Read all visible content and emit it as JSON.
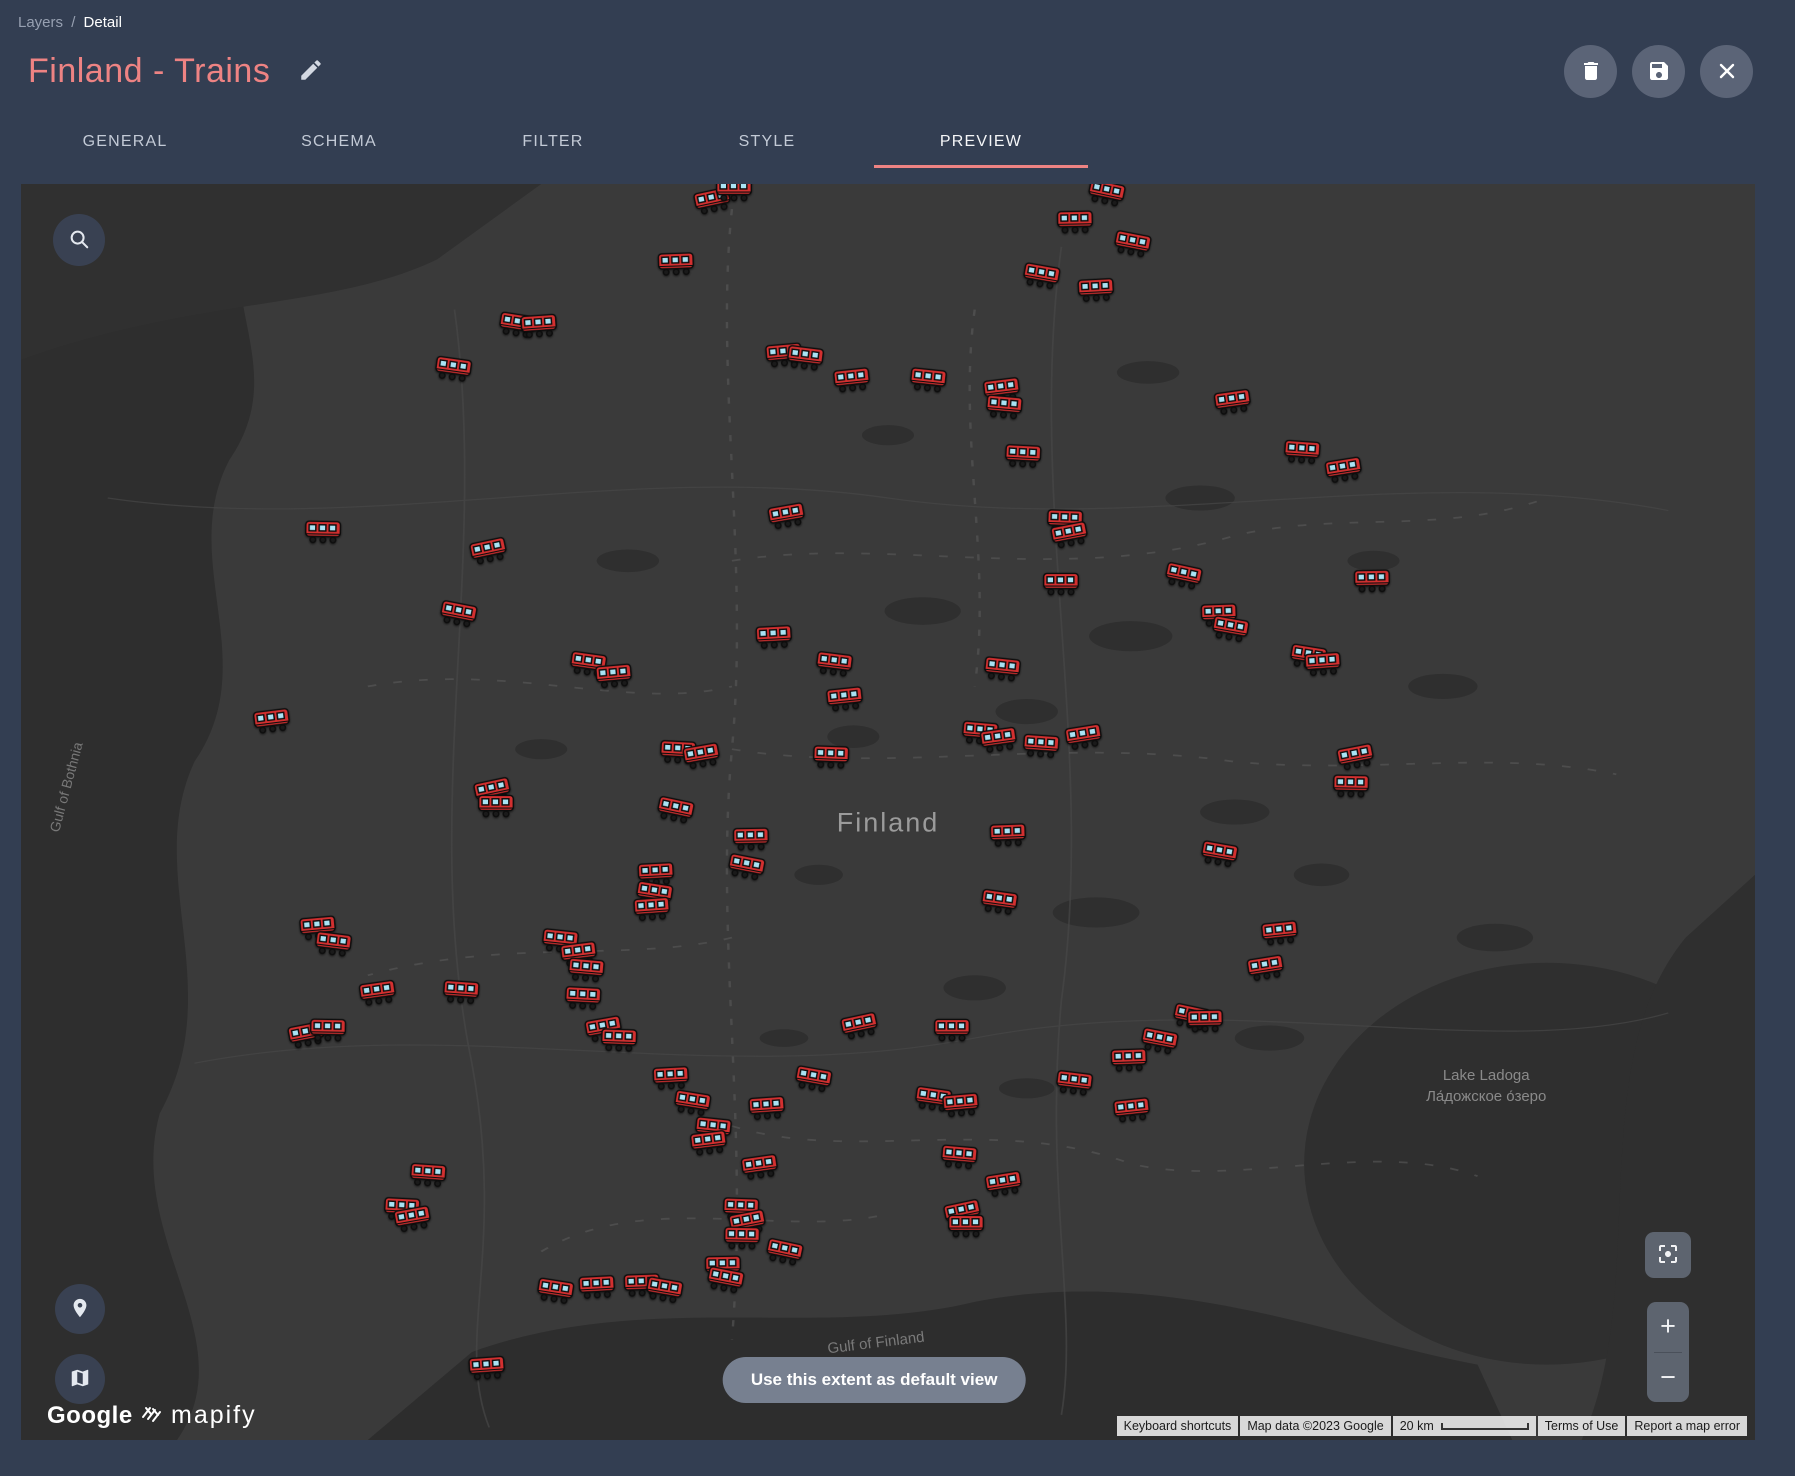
{
  "breadcrumb": {
    "parent": "Layers",
    "separator": "/",
    "current": "Detail"
  },
  "header": {
    "title": "Finland - Trains"
  },
  "tabs": [
    "GENERAL",
    "SCHEMA",
    "FILTER",
    "STYLE",
    "PREVIEW"
  ],
  "active_tab": "PREVIEW",
  "colors": {
    "accent": "#ee8383",
    "page_bg": "#333e52",
    "train_body": "#d33030",
    "train_window": "#a9e3f4"
  },
  "map": {
    "labels": {
      "country": "Finland",
      "gulf_of_bothnia": "Gulf of Bothnia",
      "lake_ladoga_en": "Lake Ladoga",
      "lake_ladoga_ru": "Ла́дожское о́зеро",
      "gulf_of_finland": "Gulf of Finland"
    },
    "extent_button_label": "Use this extent as default view",
    "google_logo": "Google",
    "mapify_logo": "mapify",
    "controls": {
      "zoom_in": "+",
      "zoom_out": "−"
    },
    "attribution": {
      "keyboard_shortcuts": "Keyboard shortcuts",
      "map_data": "Map data ©2023 Google",
      "scale": "20 km",
      "terms": "Terms of Use",
      "report": "Report a map error"
    },
    "markers": [
      [
        39.9,
        1.5
      ],
      [
        41.1,
        0.6
      ],
      [
        62.6,
        0.9
      ],
      [
        60.8,
        3.2
      ],
      [
        64.1,
        4.9
      ],
      [
        37.8,
        6.5
      ],
      [
        58.8,
        7.5
      ],
      [
        62.0,
        8.6
      ],
      [
        28.6,
        11.4
      ],
      [
        29.9,
        11.5
      ],
      [
        24.9,
        14.9
      ],
      [
        44.0,
        13.8
      ],
      [
        45.2,
        14.0
      ],
      [
        47.9,
        15.8
      ],
      [
        52.3,
        15.8
      ],
      [
        56.6,
        16.6
      ],
      [
        56.7,
        17.9
      ],
      [
        69.9,
        17.5
      ],
      [
        73.9,
        21.5
      ],
      [
        76.3,
        22.9
      ],
      [
        57.8,
        21.8
      ],
      [
        44.2,
        26.6
      ],
      [
        60.2,
        27.0
      ],
      [
        60.5,
        28.1
      ],
      [
        17.4,
        27.9
      ],
      [
        27.0,
        29.4
      ],
      [
        60.0,
        32.0
      ],
      [
        67.0,
        31.4
      ],
      [
        77.9,
        31.8
      ],
      [
        25.2,
        34.4
      ],
      [
        69.1,
        34.5
      ],
      [
        69.7,
        35.6
      ],
      [
        43.4,
        36.2
      ],
      [
        74.2,
        37.8
      ],
      [
        75.1,
        38.4
      ],
      [
        32.7,
        38.4
      ],
      [
        34.2,
        39.3
      ],
      [
        46.9,
        38.4
      ],
      [
        47.5,
        41.2
      ],
      [
        56.6,
        38.8
      ],
      [
        14.5,
        42.9
      ],
      [
        55.3,
        43.9
      ],
      [
        56.4,
        44.4
      ],
      [
        58.8,
        44.9
      ],
      [
        61.3,
        44.2
      ],
      [
        37.9,
        45.4
      ],
      [
        39.3,
        45.7
      ],
      [
        46.7,
        45.8
      ],
      [
        77.0,
        45.8
      ],
      [
        76.7,
        48.1
      ],
      [
        27.2,
        48.5
      ],
      [
        27.4,
        49.7
      ],
      [
        37.7,
        50.0
      ],
      [
        42.1,
        52.3
      ],
      [
        41.8,
        54.5
      ],
      [
        56.9,
        52.0
      ],
      [
        69.1,
        53.5
      ],
      [
        36.6,
        55.1
      ],
      [
        36.5,
        56.7
      ],
      [
        36.4,
        57.9
      ],
      [
        56.4,
        57.3
      ],
      [
        17.1,
        59.4
      ],
      [
        18.0,
        60.7
      ],
      [
        72.6,
        59.8
      ],
      [
        31.1,
        60.4
      ],
      [
        32.2,
        61.5
      ],
      [
        32.6,
        62.7
      ],
      [
        20.6,
        64.6
      ],
      [
        25.4,
        64.5
      ],
      [
        71.8,
        62.6
      ],
      [
        32.4,
        65.0
      ],
      [
        33.6,
        67.4
      ],
      [
        34.5,
        68.3
      ],
      [
        16.5,
        67.9
      ],
      [
        17.7,
        67.5
      ],
      [
        48.4,
        67.2
      ],
      [
        53.7,
        67.5
      ],
      [
        67.5,
        66.5
      ],
      [
        68.3,
        66.8
      ],
      [
        65.6,
        68.4
      ],
      [
        63.9,
        69.9
      ],
      [
        45.7,
        71.4
      ],
      [
        37.5,
        71.3
      ],
      [
        38.7,
        73.3
      ],
      [
        43.0,
        73.7
      ],
      [
        52.6,
        73.0
      ],
      [
        54.2,
        73.5
      ],
      [
        60.7,
        71.7
      ],
      [
        64.1,
        73.9
      ],
      [
        39.9,
        75.4
      ],
      [
        39.7,
        76.5
      ],
      [
        54.1,
        77.6
      ],
      [
        42.6,
        78.4
      ],
      [
        23.5,
        79.1
      ],
      [
        56.7,
        79.8
      ],
      [
        22.0,
        81.8
      ],
      [
        22.6,
        82.6
      ],
      [
        41.5,
        81.8
      ],
      [
        41.9,
        82.9
      ],
      [
        41.6,
        84.1
      ],
      [
        54.3,
        82.1
      ],
      [
        54.5,
        83.1
      ],
      [
        44.0,
        85.2
      ],
      [
        40.5,
        86.4
      ],
      [
        40.6,
        87.4
      ],
      [
        35.8,
        87.8
      ],
      [
        37.1,
        88.2
      ],
      [
        33.2,
        88.0
      ],
      [
        30.8,
        88.3
      ],
      [
        26.9,
        94.4
      ]
    ]
  }
}
